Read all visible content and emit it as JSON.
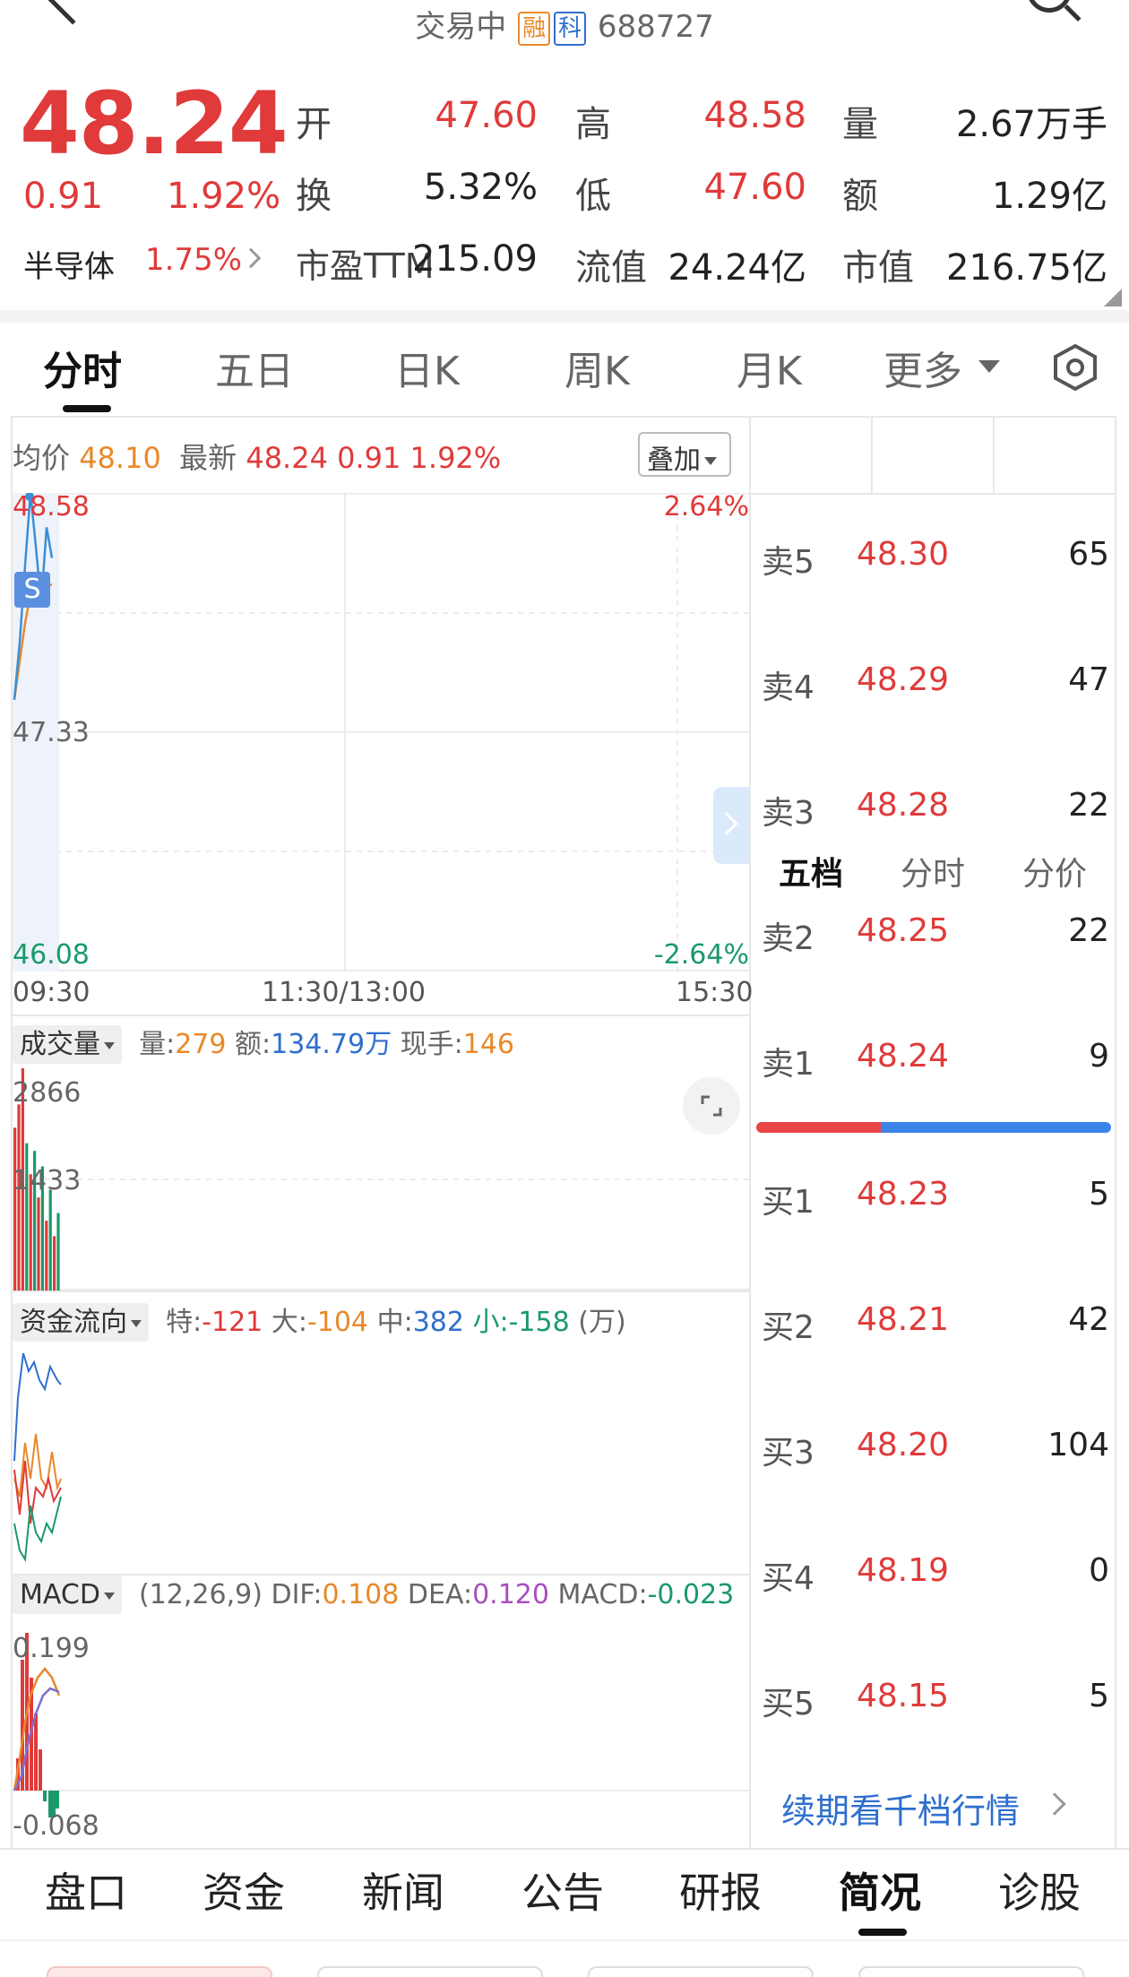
{
  "header": {
    "status": "交易中",
    "tag_margin": "融",
    "tag_star": "科",
    "code": "688727"
  },
  "quote": {
    "price": "48.24",
    "change": "0.91",
    "change_pct": "1.92%",
    "sector_name": "半导体",
    "sector_pct": "1.75%",
    "fields": [
      {
        "label": "开",
        "value": "47.60",
        "color": "#e03a3a"
      },
      {
        "label": "高",
        "value": "48.58",
        "color": "#e03a3a"
      },
      {
        "label": "量",
        "value": "2.67万手",
        "color": "#222222"
      },
      {
        "label": "换",
        "value": "5.32%",
        "color": "#222222"
      },
      {
        "label": "低",
        "value": "47.60",
        "color": "#e03a3a"
      },
      {
        "label": "额",
        "value": "1.29亿",
        "color": "#222222"
      },
      {
        "label": "市盈TTM",
        "value": "215.09",
        "color": "#222222"
      },
      {
        "label": "流值",
        "value": "24.24亿",
        "color": "#222222"
      },
      {
        "label": "市值",
        "value": "216.75亿",
        "color": "#222222"
      }
    ]
  },
  "tabs": [
    "分时",
    "五日",
    "日K",
    "周K",
    "月K",
    "更多"
  ],
  "timeshare": {
    "avg_label": "均价",
    "avg_value": "48.10",
    "latest_label": "最新",
    "latest_value": "48.24",
    "latest_change": "0.91",
    "latest_pct": "1.92%",
    "overlay_label": "叠加",
    "y_high": "48.58",
    "y_mid": "47.33",
    "y_low": "46.08",
    "pct_high": "2.64%",
    "pct_low": "-2.64%",
    "signal_badge": "S",
    "time_start": "09:30",
    "time_mid": "11:30/13:00",
    "time_end": "15:30",
    "price_series": [
      47.5,
      47.8,
      48.2,
      48.58,
      48.3,
      48.0,
      48.4,
      48.24
    ],
    "avg_series": [
      47.5,
      47.7,
      47.9,
      48.05,
      48.1,
      48.08,
      48.1,
      48.1
    ]
  },
  "volume": {
    "dropdown": "成交量",
    "vol_label": "量:",
    "vol_value": "279",
    "amt_label": "额:",
    "amt_value": "134.79万",
    "hand_label": "现手:",
    "hand_value": "146",
    "y_high": "2866",
    "y_mid": "1433",
    "bars": [
      {
        "v": 2100,
        "up": true
      },
      {
        "v": 2400,
        "up": true
      },
      {
        "v": 2866,
        "up": true
      },
      {
        "v": 1900,
        "up": false
      },
      {
        "v": 1500,
        "up": true
      },
      {
        "v": 1800,
        "up": false
      },
      {
        "v": 1200,
        "up": true
      },
      {
        "v": 1600,
        "up": false
      },
      {
        "v": 900,
        "up": true
      },
      {
        "v": 1300,
        "up": false
      },
      {
        "v": 700,
        "up": true
      },
      {
        "v": 1000,
        "up": false
      }
    ]
  },
  "fundflow": {
    "dropdown": "资金流向",
    "special_label": "特:",
    "special_value": "-121",
    "large_label": "大:",
    "large_value": "-104",
    "medium_label": "中:",
    "medium_value": "382",
    "small_label": "小:",
    "small_value": "-158",
    "unit": "(万)"
  },
  "macd": {
    "dropdown": "MACD",
    "params": "(12,26,9)",
    "dif_label": "DIF:",
    "dif_value": "0.108",
    "dea_label": "DEA:",
    "dea_value": "0.120",
    "macd_label": "MACD:",
    "macd_value": "-0.023",
    "y_high": "0.199",
    "y_low": "-0.068"
  },
  "orderbook": {
    "tabs": [
      "五档",
      "分时",
      "分价"
    ],
    "asks": [
      {
        "label": "卖5",
        "price": "48.30",
        "vol": "65"
      },
      {
        "label": "卖4",
        "price": "48.29",
        "vol": "47"
      },
      {
        "label": "卖3",
        "price": "48.28",
        "vol": "22"
      },
      {
        "label": "卖2",
        "price": "48.25",
        "vol": "22"
      },
      {
        "label": "卖1",
        "price": "48.24",
        "vol": "9"
      }
    ],
    "bids": [
      {
        "label": "买1",
        "price": "48.23",
        "vol": "5"
      },
      {
        "label": "买2",
        "price": "48.21",
        "vol": "42"
      },
      {
        "label": "买3",
        "price": "48.20",
        "vol": "104"
      },
      {
        "label": "买4",
        "price": "48.19",
        "vol": "0"
      },
      {
        "label": "买5",
        "price": "48.15",
        "vol": "5"
      }
    ],
    "buy_ratio": 0.35,
    "more_link": "续期看千档行情"
  },
  "bottom_tabs": [
    "盘口",
    "资金",
    "新闻",
    "公告",
    "研报",
    "简况",
    "诊股"
  ],
  "colors": {
    "up": "#e03a3a",
    "down": "#1a9a6a",
    "accent_blue": "#2f6fce",
    "orange": "#e8892a"
  }
}
